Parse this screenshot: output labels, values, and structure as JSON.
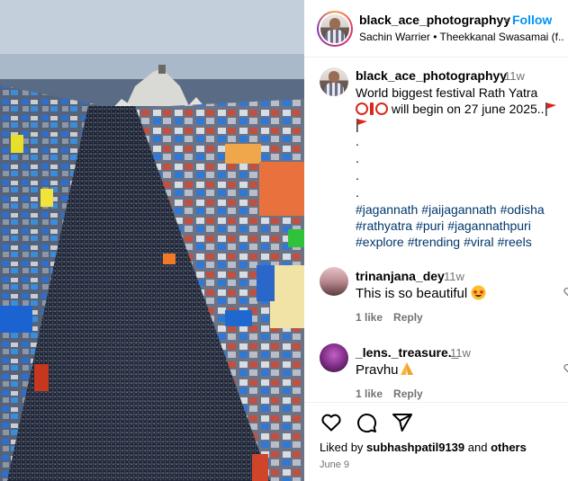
{
  "post": {
    "author": "black_ace_photographyy",
    "separator": "•",
    "follow_label": "Follow",
    "subtitle": "Sachin Warrier • Theekkanal Swasamai (f..."
  },
  "caption": {
    "author": "black_ace_photographyy",
    "time": "11w",
    "line1": "World biggest festival Rath Yatra",
    "line2": "will begin on 27 june 2025..",
    "dots": [
      ".",
      ".",
      ".",
      "."
    ],
    "hashtags_line1": [
      "#jagannath",
      "#jaijagannath",
      "#odisha"
    ],
    "hashtags_line2": [
      "#rathyatra",
      "#puri",
      "#jagannathpuri"
    ],
    "hashtags_line3": [
      "#explore",
      "#trending",
      "#viral",
      "#reels"
    ]
  },
  "comments": [
    {
      "user": "trinanjana_dey",
      "time": "11w",
      "text": "This is so beautiful",
      "likes": "1 like",
      "reply": "Reply"
    },
    {
      "user": "_lens._treasure._",
      "time": "11w",
      "text": "Pravhu",
      "likes": "1 like",
      "reply": "Reply"
    }
  ],
  "footer": {
    "liked_prefix": "Liked by",
    "liked_user": "subhashpatil9139",
    "liked_and": "and",
    "liked_others": "others",
    "date": "June 9"
  },
  "icons": {
    "like": "heart-icon",
    "comment": "comment-icon",
    "share": "share-icon",
    "comment_like": "small-heart-icon",
    "flag": "red-flag-emoji",
    "star_eyes": "star-struck-emoji",
    "pray": "folded-hands-emoji"
  },
  "colors": {
    "link": "#0095f6",
    "hashtag": "#00376b",
    "muted": "#737373"
  }
}
